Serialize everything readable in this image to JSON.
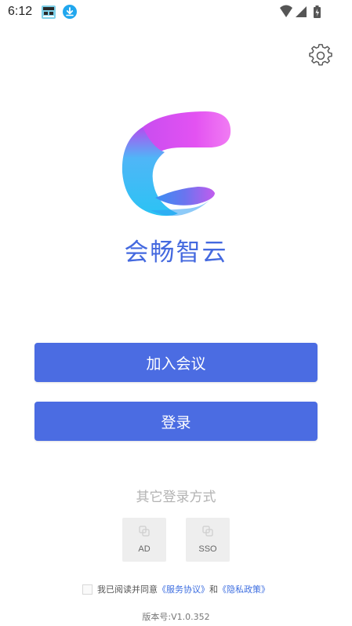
{
  "status_bar": {
    "time": "6:12",
    "icons": [
      "app-notification-icon",
      "download-icon",
      "wifi-icon",
      "signal-icon",
      "battery-charging-icon"
    ]
  },
  "header": {
    "settings_icon": "gear-icon"
  },
  "brand": {
    "name": "会畅智云",
    "logo": "app-logo",
    "colors": {
      "text": "#4469df",
      "logo_magenta": "#e052f0",
      "logo_cyan": "#2fc3f5",
      "logo_blue": "#3f86f2"
    }
  },
  "actions": {
    "join_meeting_label": "加入会议",
    "login_label": "登录",
    "button_color": "#4b6ce2"
  },
  "other_login": {
    "title": "其它登录方式",
    "options": [
      {
        "label": "AD",
        "icon": "link-icon"
      },
      {
        "label": "SSO",
        "icon": "link-icon"
      }
    ]
  },
  "agreement": {
    "prefix": "我已阅读并同意",
    "service_link": "《服务协议》",
    "conjunction": "和",
    "privacy_link": "《隐私政策》",
    "checked": false
  },
  "version": "版本号:V1.0.352"
}
